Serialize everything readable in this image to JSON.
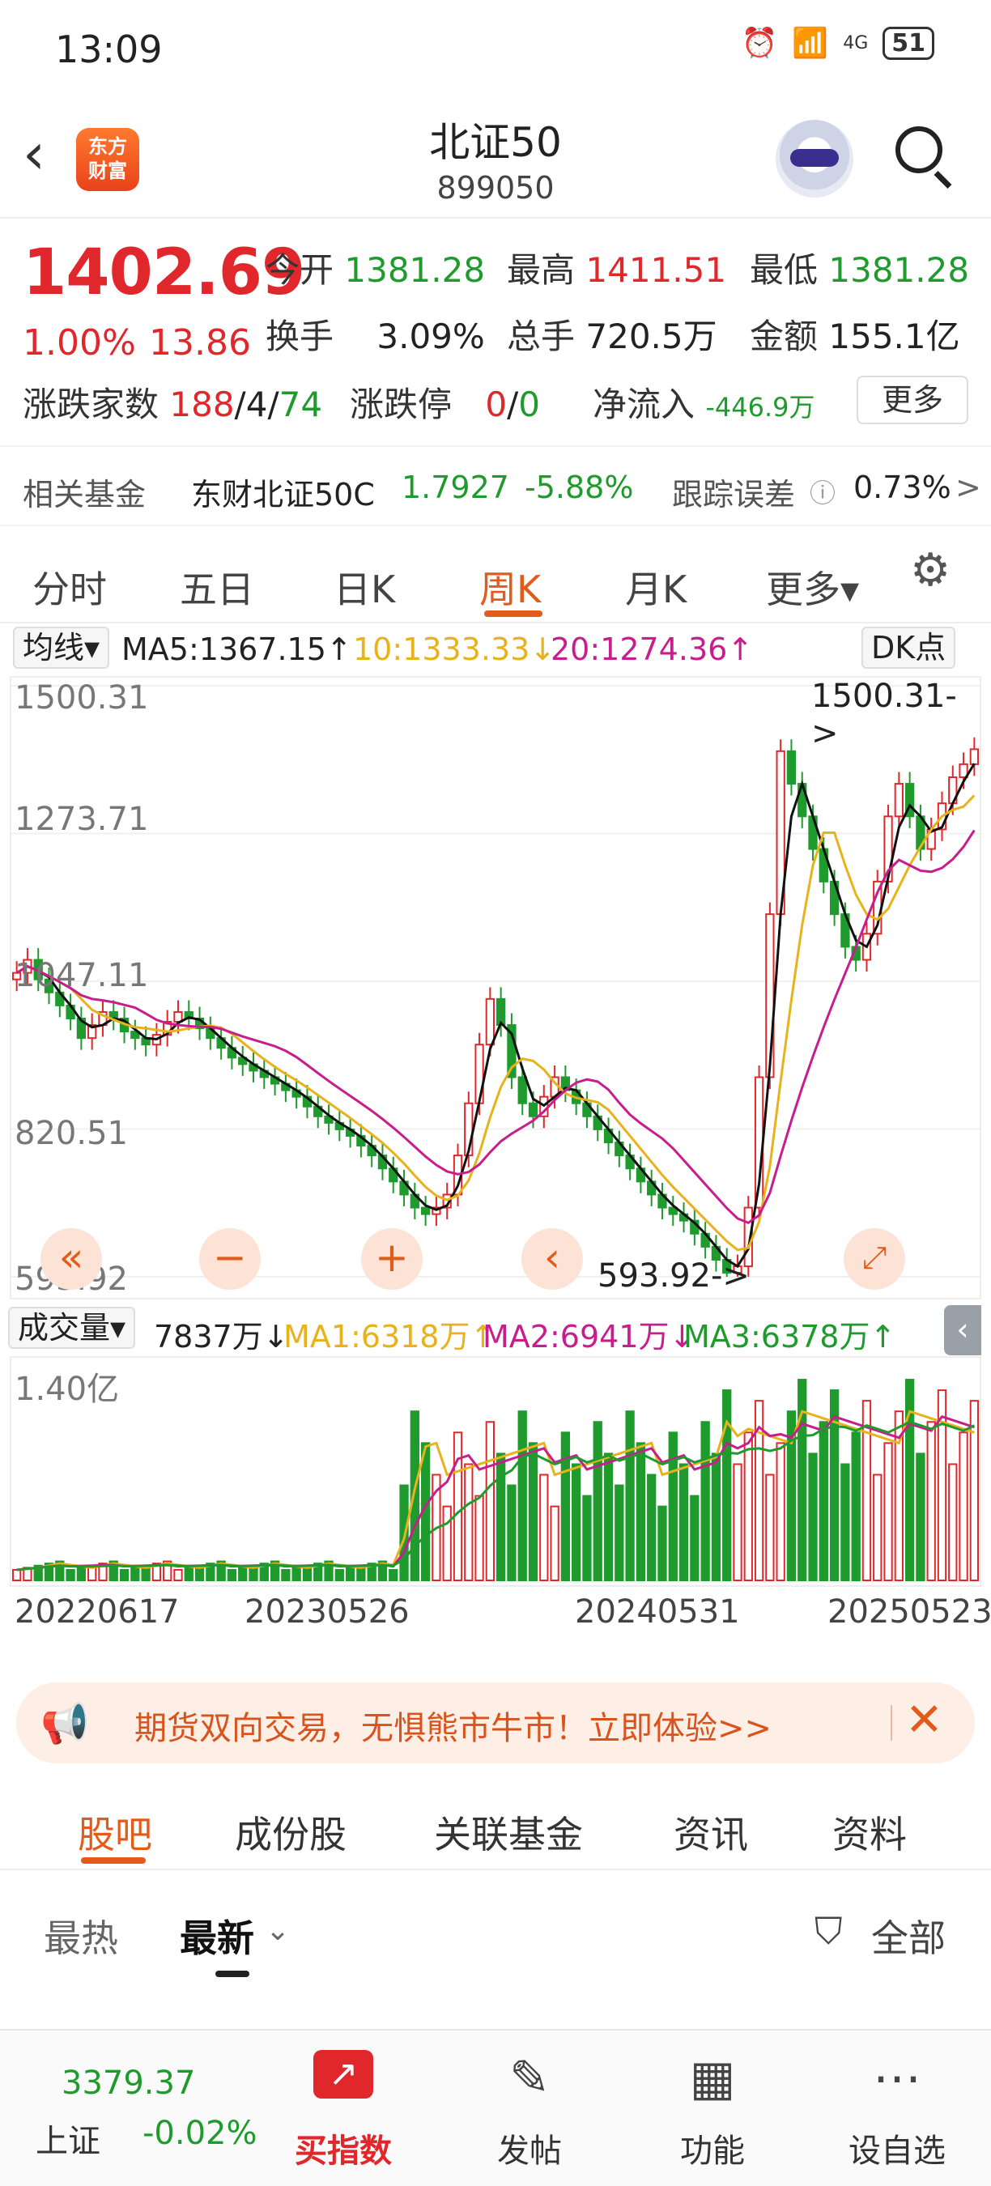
{
  "status_bar": {
    "time": "13:09",
    "signal": "4G",
    "battery": "51"
  },
  "header": {
    "logo_line1": "东方",
    "logo_line2": "财富",
    "title": "北证50",
    "code": "899050"
  },
  "quote": {
    "price": "1402.69",
    "change_pct": "1.00%",
    "change_abs": "13.86",
    "open_label": "今开",
    "open": "1381.28",
    "high_label": "最高",
    "high": "1411.51",
    "low_label": "最低",
    "low": "1381.28",
    "turnover_label": "换手",
    "turnover": "3.09%",
    "volume_label": "总手",
    "volume": "720.5万",
    "amount_label": "金额",
    "amount": "155.1亿",
    "breadth_label": "涨跌家数",
    "breadth_up": "188",
    "sep1": "/",
    "breadth_flat": "4",
    "sep2": "/",
    "breadth_down": "74",
    "limit_label": "涨跌停",
    "limit_up": "0",
    "sep3": "/",
    "limit_down": "0",
    "netflow_label": "净流入",
    "netflow": "-446.9万",
    "more_button": "更多"
  },
  "fund": {
    "label": "相关基金",
    "name": "东财北证50C",
    "nav": "1.7927",
    "change": "-5.88%",
    "tracking_label": "跟踪误差",
    "tracking_value": "0.73%",
    "arrow": ">"
  },
  "period_tabs": [
    "分时",
    "五日",
    "日K",
    "周K",
    "月K",
    "更多▾"
  ],
  "ma_legend": {
    "selector": "均线▾",
    "ma5": "MA5:1367.15↑",
    "ma10": "10:1333.33↓",
    "ma20": "20:1274.36↑",
    "dk_button": "DK点"
  },
  "chart_data": {
    "type": "candlestick",
    "y_ticks": [
      "1500.31",
      "1273.71",
      "1047.11",
      "820.51",
      "593.92"
    ],
    "max_label": "1500.31->",
    "min_label": "593.92->",
    "close_series": [
      1060,
      1080,
      1050,
      1030,
      1010,
      990,
      960,
      980,
      1000,
      990,
      970,
      960,
      950,
      965,
      985,
      1000,
      990,
      975,
      960,
      945,
      930,
      920,
      910,
      900,
      890,
      880,
      870,
      855,
      840,
      830,
      820,
      810,
      795,
      780,
      760,
      740,
      720,
      700,
      690,
      700,
      720,
      780,
      860,
      950,
      1020,
      980,
      900,
      860,
      840,
      870,
      900,
      880,
      860,
      840,
      820,
      800,
      780,
      760,
      740,
      720,
      700,
      690,
      680,
      660,
      640,
      620,
      600,
      610,
      700,
      900,
      1150,
      1400,
      1350,
      1300,
      1250,
      1200,
      1150,
      1100,
      1080,
      1120,
      1200,
      1300,
      1350,
      1300,
      1250,
      1280,
      1320,
      1360,
      1380,
      1403
    ],
    "ma_colors": {
      "ma5": "#111111",
      "ma10": "#e8b21c",
      "ma20": "#c81d8c"
    },
    "up_color": "#e0272b",
    "down_color": "#1f9b2e",
    "volume": {
      "legend_selector": "成交量▾",
      "current": "7837万↓",
      "ma1": "MA1:6318万↑",
      "ma2": "MA2:6941万↓",
      "ma3": "MA3:6378万↑",
      "y_label": "1.40亿"
    },
    "x_ticks": [
      "20220617",
      "20230526",
      "20240531",
      "20250523"
    ]
  },
  "banner": {
    "text": "期货双向交易，无惧熊市牛市！立即体验>>"
  },
  "sub_tabs": [
    "股吧",
    "成份股",
    "关联基金",
    "资讯",
    "资料"
  ],
  "sort_tabs": {
    "hot": "最热",
    "newest": "最新",
    "filter": "全部"
  },
  "bottom_bar": {
    "index_value": "3379.37",
    "index_name": "上证",
    "index_change": "-0.02%",
    "buy_index": "买指数",
    "post": "发帖",
    "functions": "功能",
    "watchlist": "设自选"
  }
}
